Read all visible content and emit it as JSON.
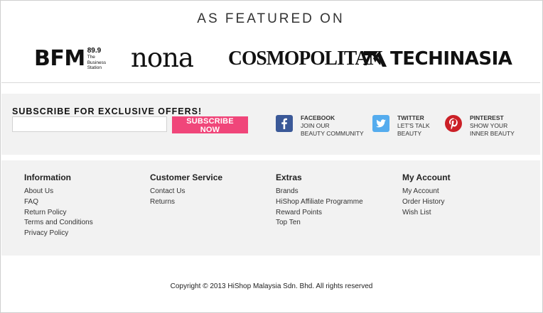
{
  "featured": {
    "title": "AS FEATURED ON",
    "logos": {
      "bfm": {
        "name": "BFM",
        "freq": "89.9",
        "tagline_1": "The",
        "tagline_2": "Business",
        "tagline_3": "Station"
      },
      "nona": "nona",
      "cosmopolitan": "COSMOPOLITAN",
      "techinasia": "TECHINASIA"
    }
  },
  "subscribe": {
    "title": "SUBSCRIBE FOR EXCLUSIVE OFFERS!",
    "email_placeholder": "",
    "button_label": "SUBSCRIBE NOW"
  },
  "social": {
    "facebook": {
      "icon": "facebook-icon",
      "color": "#3b5998",
      "head": "FACEBOOK",
      "line1": "JOIN OUR",
      "line2": "BEAUTY COMMUNITY"
    },
    "twitter": {
      "icon": "twitter-icon",
      "color": "#55acee",
      "head": "TWITTER",
      "line1": "LET'S TALK",
      "line2": "BEAUTY"
    },
    "pinterest": {
      "icon": "pinterest-icon",
      "color": "#cb2027",
      "head": "PINTEREST",
      "line1": "SHOW YOUR",
      "line2": "INNER BEAUTY"
    }
  },
  "footer": {
    "information": {
      "title": "Information",
      "links": [
        "About Us",
        "FAQ",
        "Return Policy",
        "Terms and Conditions",
        "Privacy Policy"
      ]
    },
    "customer_service": {
      "title": "Customer Service",
      "links": [
        "Contact Us",
        "Returns"
      ]
    },
    "extras": {
      "title": "Extras",
      "links": [
        "Brands",
        "HiShop Affiliate Programme",
        "Reward Points",
        "Top Ten"
      ]
    },
    "my_account": {
      "title": "My Account",
      "links": [
        "My Account",
        "Order History",
        "Wish List"
      ]
    }
  },
  "copyright": "Copyright © 2013 HiShop Malaysia Sdn. Bhd. All rights reserved",
  "colors": {
    "accent": "#f0467a",
    "band_bg": "#f2f2f2"
  }
}
